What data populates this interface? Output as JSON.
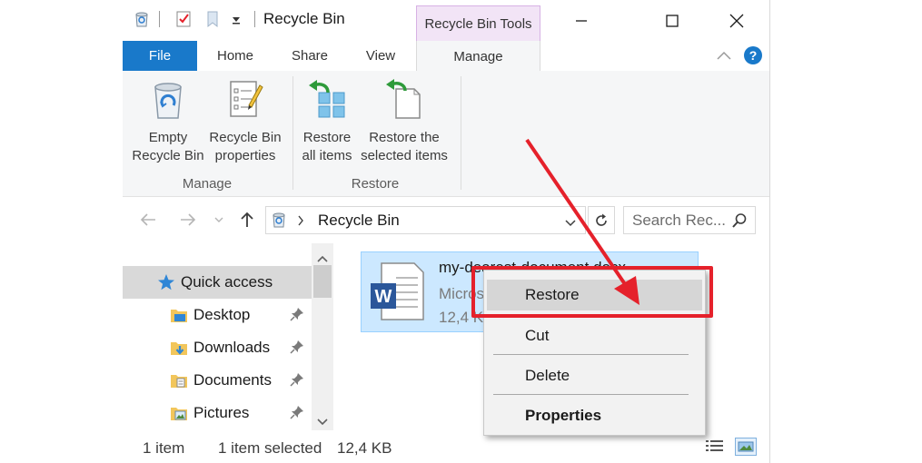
{
  "window": {
    "title": "Recycle Bin",
    "contextual_tab_group": "Recycle Bin Tools"
  },
  "tabs": [
    {
      "label": "File"
    },
    {
      "label": "Home"
    },
    {
      "label": "Share"
    },
    {
      "label": "View"
    },
    {
      "label": "Manage"
    }
  ],
  "ribbon": {
    "manage_group": {
      "label": "Manage",
      "empty_label_1": "Empty",
      "empty_label_2": "Recycle Bin",
      "props_label_1": "Recycle Bin",
      "props_label_2": "properties"
    },
    "restore_group": {
      "label": "Restore",
      "restore_all_1": "Restore",
      "restore_all_2": "all items",
      "restore_sel_1": "Restore the",
      "restore_sel_2": "selected items"
    }
  },
  "address": {
    "path": "Recycle Bin",
    "search_placeholder": "Search Rec..."
  },
  "navpane": {
    "items": [
      {
        "label": "Quick access",
        "icon": "star-icon",
        "pinned": false
      },
      {
        "label": "Desktop",
        "icon": "folder-desktop-icon",
        "pinned": true
      },
      {
        "label": "Downloads",
        "icon": "folder-downloads-icon",
        "pinned": true
      },
      {
        "label": "Documents",
        "icon": "folder-documents-icon",
        "pinned": true
      },
      {
        "label": "Pictures",
        "icon": "folder-pictures-icon",
        "pinned": true
      }
    ]
  },
  "file": {
    "name": "my-dearest-document.docx",
    "type": "Micros",
    "size": "12,4 K"
  },
  "context_menu": {
    "items": [
      "Restore",
      "Cut",
      "Delete",
      "Properties"
    ]
  },
  "status": {
    "count": "1 item",
    "selected": "1 item selected",
    "size": "12,4 KB"
  },
  "colors": {
    "file_tab": "#1979ca",
    "selection": "#cce8ff",
    "contextual_tab": "#f2e4f6",
    "annotation_red": "#e5212b"
  }
}
